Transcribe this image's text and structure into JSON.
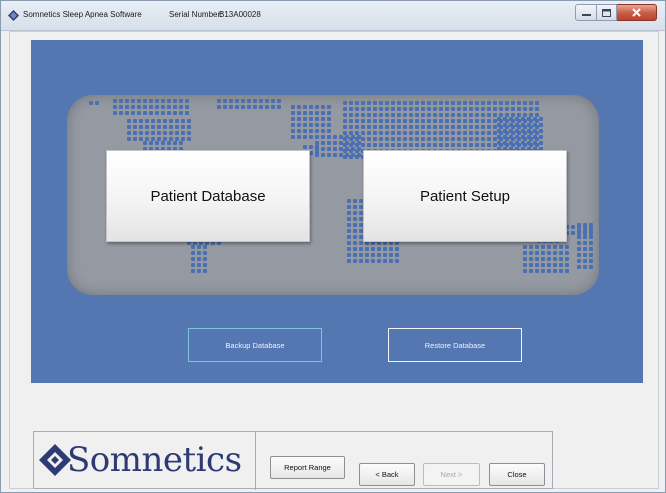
{
  "window": {
    "app_title": "Somnetics Sleep Apnea Software",
    "serial_label": "Serial Number:",
    "serial_value": "B13A00028",
    "icons": {
      "app": "diamond-logo-icon",
      "minimize": "minimize-icon",
      "maximize": "maximize-icon",
      "close": "close-icon"
    }
  },
  "main": {
    "patient_database_label": "Patient Database",
    "patient_setup_label": "Patient Setup",
    "backup_database_label": "Backup Database",
    "restore_database_label": "Restore Database",
    "background_image": "world-map-dots"
  },
  "footer": {
    "logo_text": "Somnetics",
    "report_range_label": "Report Range",
    "back_label": "< Back",
    "next_label": "Next >",
    "close_label": "Close",
    "next_enabled": false
  },
  "colors": {
    "panel_blue": "#5477b1",
    "map_gray": "#959aa2",
    "map_dots": "#4a6fb2",
    "logo_navy": "#2e3a73",
    "close_red": "#c75b45"
  }
}
